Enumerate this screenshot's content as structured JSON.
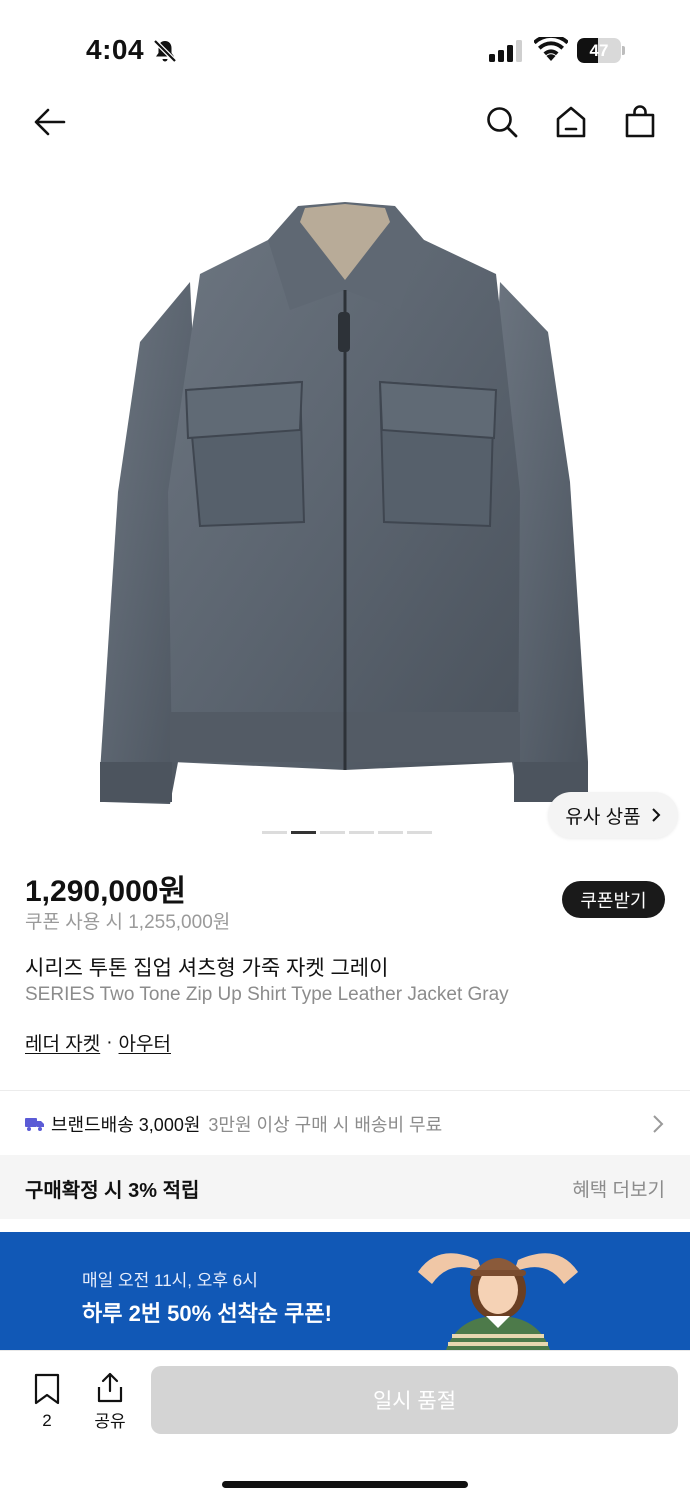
{
  "status_bar": {
    "time": "4:04",
    "battery_level": "47",
    "battery_fraction": 0.47
  },
  "nav": {
    "icons": [
      "back-arrow-icon",
      "search-icon",
      "home-icon",
      "shopping-bag-icon"
    ]
  },
  "gallery": {
    "similar_label": "유사 상품",
    "page_count": 6,
    "active_page": 2
  },
  "product": {
    "price": "1,290,000원",
    "coupon_price": "쿠폰 사용 시 1,255,000원",
    "coupon_button": "쿠폰받기",
    "title_ko": "시리즈 투톤 집업 셔츠형 가죽 자켓 그레이",
    "title_en": "SERIES Two Tone Zip Up Shirt Type Leather Jacket Gray",
    "category_1": "레더 자켓",
    "category_sep": "·",
    "category_2": "아우터"
  },
  "shipping": {
    "label": "브랜드배송 3,000원",
    "note": "3만원 이상 구매 시 배송비 무료",
    "icon_color": "#5b5bd6"
  },
  "points": {
    "text": "구매확정 시 3% 적립",
    "more": "혜택 더보기"
  },
  "banner": {
    "sub": "매일 오전 11시, 오후 6시",
    "main": "하루 2번 50% 선착순 쿠폰!",
    "bg_color": "#1158b6"
  },
  "bottom_bar": {
    "bookmark_count": "2",
    "share_label": "공유",
    "soldout_label": "일시 품절"
  }
}
